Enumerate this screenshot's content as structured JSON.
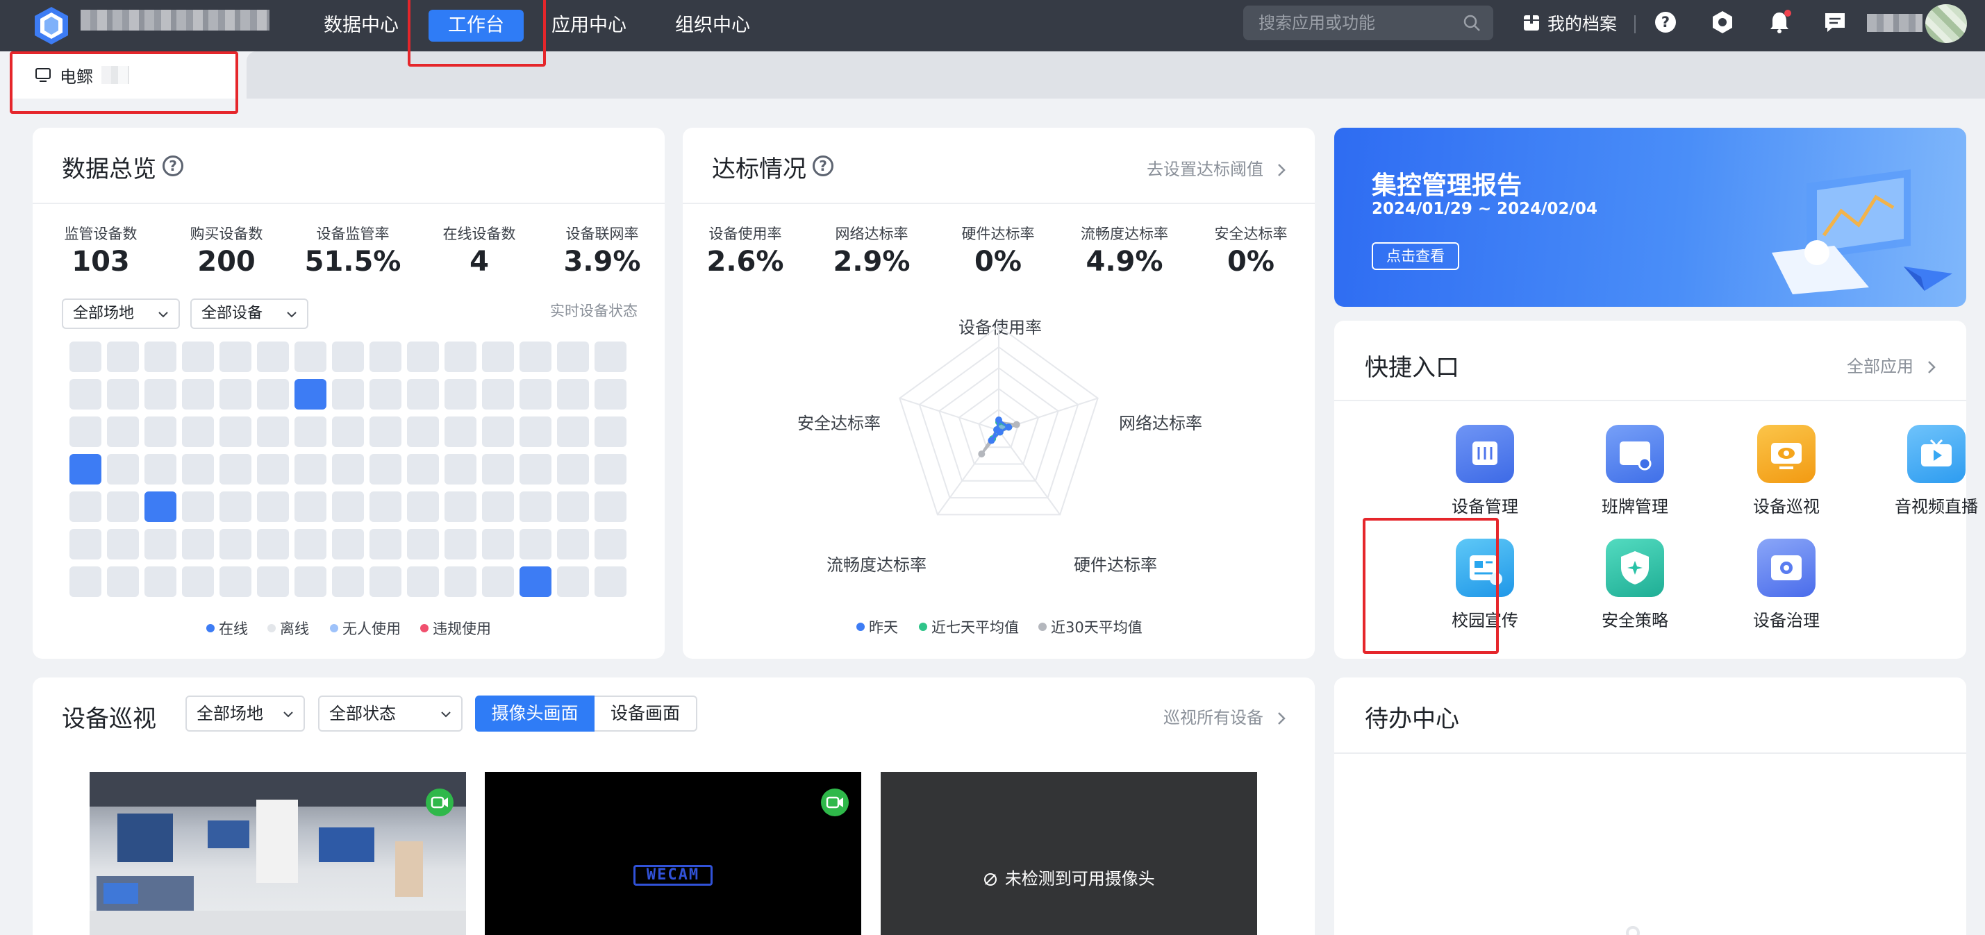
{
  "topbar": {
    "nav": [
      "数据中心",
      "工作台",
      "应用中心",
      "组织中心"
    ],
    "active_nav": "工作台",
    "search_placeholder": "搜索应用或功能",
    "archive_label": "我的档案"
  },
  "tabs": {
    "active_label": "电鳏"
  },
  "overview": {
    "title": "数据总览",
    "stats": [
      {
        "label": "监管设备数",
        "value": "103"
      },
      {
        "label": "购买设备数",
        "value": "200"
      },
      {
        "label": "设备监管率",
        "value": "51.5%"
      },
      {
        "label": "在线设备数",
        "value": "4"
      },
      {
        "label": "设备联网率",
        "value": "3.9%"
      }
    ],
    "filters": [
      "全部场地",
      "全部设备"
    ],
    "realtime_label": "实时设备状态",
    "grid": {
      "rows": 7,
      "cols": 15,
      "online_cells": [
        [
          1,
          6
        ],
        [
          3,
          0
        ],
        [
          4,
          2
        ],
        [
          6,
          12
        ]
      ]
    },
    "legend": [
      {
        "label": "在线",
        "color": "#3d7cf4"
      },
      {
        "label": "离线",
        "color": "#e3e6ea"
      },
      {
        "label": "无人使用",
        "color": "#9ec2fa"
      },
      {
        "label": "违规使用",
        "color": "#f0506e"
      }
    ]
  },
  "compliance": {
    "title": "达标情况",
    "link": "去设置达标阈值",
    "stats": [
      {
        "label": "设备使用率",
        "value": "2.6%"
      },
      {
        "label": "网络达标率",
        "value": "2.9%"
      },
      {
        "label": "硬件达标率",
        "value": "0%"
      },
      {
        "label": "流畅度达标率",
        "value": "4.9%"
      },
      {
        "label": "安全达标率",
        "value": "0%"
      }
    ],
    "radar_axes": [
      "设备使用率",
      "网络达标率",
      "硬件达标率",
      "流畅度达标率",
      "安全达标率"
    ],
    "radar_series": [
      {
        "name": "昨天",
        "color": "#3d7cf4",
        "values": [
          0.1,
          0.1,
          0.02,
          0.12,
          0.02
        ]
      },
      {
        "name": "近七天平均值",
        "color": "#2fc489",
        "values": [
          0.08,
          0.1,
          0.02,
          0.1,
          0.02
        ]
      },
      {
        "name": "近30天平均值",
        "color": "#b4b7bd",
        "values": [
          0.08,
          0.18,
          0.02,
          0.28,
          0.02
        ]
      }
    ]
  },
  "report": {
    "title": "集控管理报告",
    "date": "2024/01/29 ~ 2024/02/04",
    "button": "点击查看"
  },
  "quick": {
    "title": "快捷入口",
    "link": "全部应用",
    "items": [
      {
        "label": "设备管理",
        "icon": "device-manage-icon",
        "color": "#4e74ec"
      },
      {
        "label": "班牌管理",
        "icon": "class-board-icon",
        "color": "#4f7ef0"
      },
      {
        "label": "设备巡视",
        "icon": "device-patrol-icon",
        "color": "#f5a51c"
      },
      {
        "label": "音视频直播",
        "icon": "live-video-icon",
        "color": "#38a8f3"
      },
      {
        "label": "校园宣传",
        "icon": "campus-promo-icon",
        "color": "#28a6ee"
      },
      {
        "label": "安全策略",
        "icon": "security-policy-icon",
        "color": "#27c2a6"
      },
      {
        "label": "设备治理",
        "icon": "device-govern-icon",
        "color": "#5a7cf0"
      }
    ]
  },
  "patrol": {
    "title": "设备巡视",
    "filters": [
      "全部场地",
      "全部状态"
    ],
    "segments": [
      "摄像头画面",
      "设备画面"
    ],
    "active_segment": "摄像头画面",
    "link": "巡视所有设备",
    "thumbs": [
      {
        "type": "room"
      },
      {
        "type": "wecam",
        "text": "WECAM"
      },
      {
        "type": "none",
        "text": "未检测到可用摄像头"
      }
    ]
  },
  "todo": {
    "title": "待办中心"
  }
}
